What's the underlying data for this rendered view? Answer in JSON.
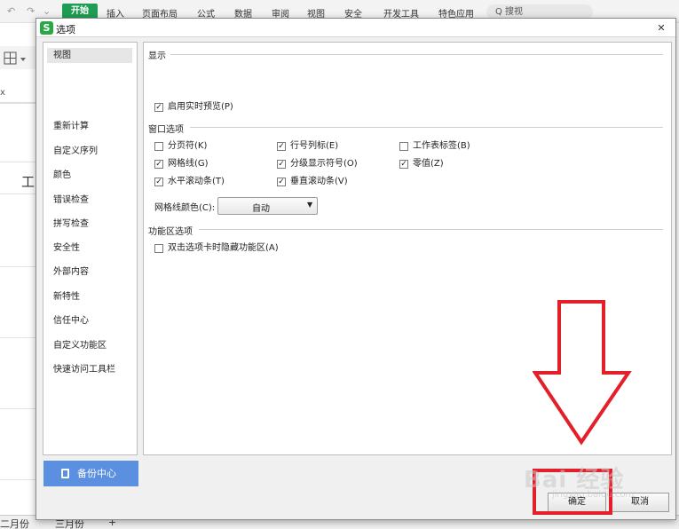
{
  "ribbon": {
    "quick_access": [
      "↶",
      "↷",
      "⌄"
    ],
    "tabs": [
      {
        "label": "开始",
        "active": true
      },
      {
        "label": "插入",
        "active": false
      },
      {
        "label": "页面布局",
        "active": false
      },
      {
        "label": "公式",
        "active": false
      },
      {
        "label": "数据",
        "active": false
      },
      {
        "label": "审阅",
        "active": false
      },
      {
        "label": "视图",
        "active": false
      },
      {
        "label": "安全",
        "active": false
      },
      {
        "label": "开发工具",
        "active": false
      },
      {
        "label": "特色应用",
        "active": false
      }
    ],
    "search_text": "Q 搜视"
  },
  "background": {
    "formula_x": "x",
    "cell_text": "工",
    "sheet_tabs": [
      "二月份",
      "三月份",
      "+"
    ]
  },
  "dialog": {
    "title": "选项",
    "app_icon": "S",
    "close_icon": "✕",
    "sidebar": {
      "items": [
        "视图",
        "重新计算",
        "自定义序列",
        "颜色",
        "错误检查",
        "拼写检查",
        "安全性",
        "外部内容",
        "新特性",
        "信任中心",
        "自定义功能区",
        "快速访问工具栏"
      ],
      "selected_index": 0
    },
    "backup_button": "备份中心",
    "sections": {
      "display": {
        "title": "显示",
        "options": [
          {
            "label": "启用实时预览(P)",
            "checked": true
          }
        ]
      },
      "window": {
        "title": "窗口选项",
        "options": [
          {
            "label": "分页符(K)",
            "checked": false
          },
          {
            "label": "行号列标(E)",
            "checked": true
          },
          {
            "label": "工作表标签(B)",
            "checked": false
          },
          {
            "label": "网格线(G)",
            "checked": true
          },
          {
            "label": "分级显示符号(O)",
            "checked": true
          },
          {
            "label": "零值(Z)",
            "checked": true
          },
          {
            "label": "水平滚动条(T)",
            "checked": true
          },
          {
            "label": "垂直滚动条(V)",
            "checked": true
          }
        ],
        "gridline_color_label": "网格线颜色(C):",
        "gridline_color_value": "自动"
      },
      "ribbon_options": {
        "title": "功能区选项",
        "options": [
          {
            "label": "双击选项卡时隐藏功能区(A)",
            "checked": false
          }
        ]
      }
    },
    "buttons": {
      "ok": "确定",
      "cancel": "取消"
    }
  },
  "annotation": {
    "color": "#e3202a",
    "watermark": "Bai 经验",
    "watermark_sub": "jingyan.baidu.com"
  }
}
